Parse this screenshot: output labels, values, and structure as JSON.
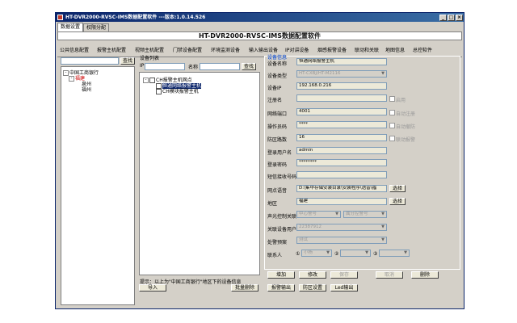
{
  "window": {
    "title": "HT-DVR2000-RVSC-IMS数据配置软件 ---版本:1.0.14.526",
    "minimize": "_",
    "maximize": "□",
    "close": "×"
  },
  "tabs": [
    "数据设置",
    "权限分配"
  ],
  "header": {
    "title": "HT-DVR2000-RVSC-IMS数据配置软件"
  },
  "modules": [
    "公共信息配置",
    "报警主机配置",
    "视频主机配置",
    "门禁设备配置",
    "环境监测设备",
    "输入输出设备",
    "IP对讲设备",
    "烟感报警设备",
    "联动和关联",
    "地图信息",
    "总控软件"
  ],
  "left_panel": {
    "search_button": "查找",
    "tree": {
      "root": "中国工商银行",
      "child": "福建",
      "grandchildren": [
        "泉州",
        "福州"
      ]
    }
  },
  "mid_panel": {
    "title": "设备列表",
    "ip_label": "IP",
    "name_label": "名称",
    "search_button": "查找",
    "tree": {
      "root": "CH报警主机网点",
      "children": [
        "恒通网络报警主机",
        "CH模块报警主机"
      ]
    },
    "hint": "提示：以上为\"中国工商银行\"地区下的设备信息",
    "import_button": "导入",
    "batch_delete_button": "批量删除"
  },
  "device_info": {
    "group_title": "设备信息",
    "fields": {
      "device_name": {
        "label": "设备名称",
        "value": "恒通网络报警主机"
      },
      "device_type": {
        "label": "设备类型",
        "value": "HT-CXBJ/HT-M2116"
      },
      "device_ip": {
        "label": "设备IP",
        "value": "192.168.0.216"
      },
      "reg_name": {
        "label": "注册名",
        "value": "",
        "checkbox": "启用"
      },
      "net_port": {
        "label": "网络端口",
        "value": "4001",
        "checkbox": "自动注册"
      },
      "op_password": {
        "label": "操作员码",
        "value": "****",
        "checkbox": "自动撤防"
      },
      "zone_count": {
        "label": "防区路数",
        "value": "16",
        "checkbox": "联动报警"
      },
      "login_user": {
        "label": "登录用户名",
        "value": "admin"
      },
      "login_password": {
        "label": "登录密码",
        "value": "********"
      },
      "sms_number": {
        "label": "短信接收号码",
        "value": ""
      },
      "site_voice": {
        "label": "网点语音",
        "value": "D:\\集中存储安装目录\\安装程序\\语音\\福",
        "button": "选择"
      },
      "region": {
        "label": "地区",
        "value": "福建",
        "button": "选择"
      },
      "sound_light": {
        "label": "声光控制关联",
        "value1": "中心警号",
        "value2": "属分控警号"
      },
      "linked_user": {
        "label": "关联设备用户",
        "value": "22387912"
      },
      "plan": {
        "label": "处警预案",
        "value": "测试"
      },
      "contacts": {
        "label": "联系人",
        "c1": "①",
        "v1": "小杨",
        "c2": "②",
        "c3": "③"
      }
    },
    "buttons": {
      "add": "增加",
      "edit": "修改",
      "save": "保存",
      "cancel": "取消",
      "delete": "删除",
      "alarm_output": "报警输出",
      "zone_setting": "防区设置",
      "led_output": "Led输出"
    }
  }
}
